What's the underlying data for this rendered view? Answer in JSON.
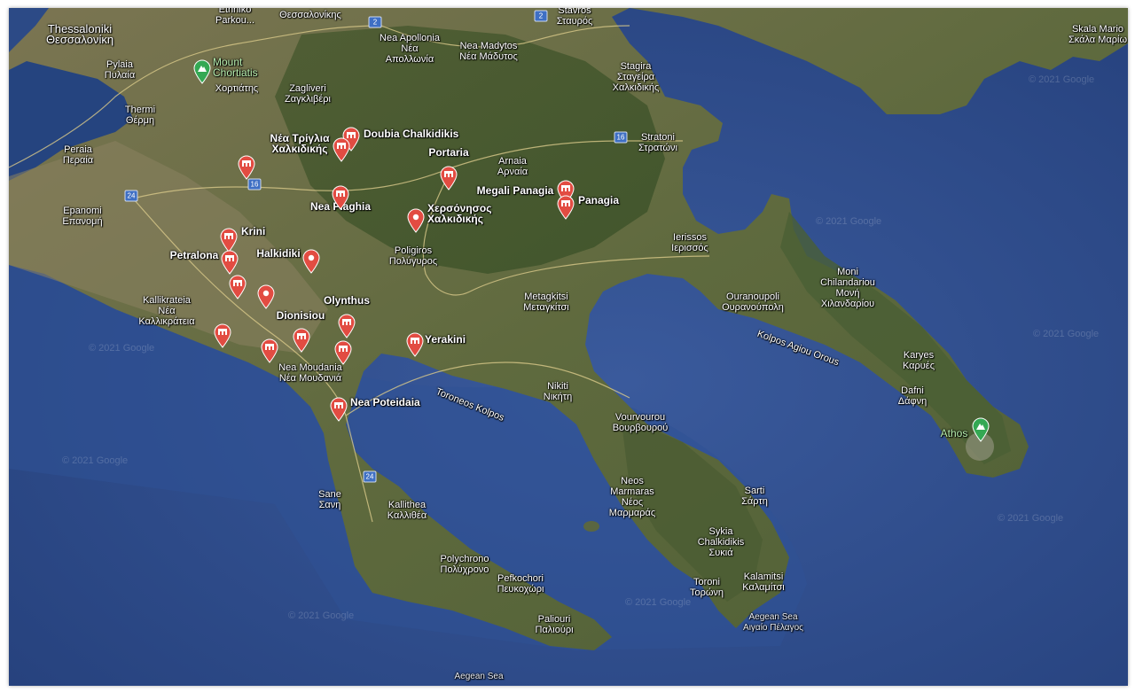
{
  "map": {
    "watermark": "© 2021 Google",
    "accent_colors": {
      "water": "#2c4a86",
      "land": "#6d6a45",
      "pin": "#e24c42",
      "park": "#34a853"
    }
  },
  "labels": {
    "thessaloniki": [
      "Thessaloniki",
      "Θεσσαλονίκη"
    ],
    "ethniko": [
      "Ethniko",
      "Parkou..."
    ],
    "thessalonikis": [
      "Θεσσαλονίκης"
    ],
    "pylaia": [
      "Pylaia",
      "Πυλαία"
    ],
    "mount_chortiatis": [
      "Mount",
      "Chortiatis"
    ],
    "chortiatis_gr": [
      "Χορτιάτης"
    ],
    "zagliveri": [
      "Zagliveri",
      "Ζαγκλιβέρι"
    ],
    "thermi": [
      "Thermi",
      "Θέρμη"
    ],
    "nea_apollonia": [
      "Nea Apollonia",
      "Νέα",
      "Απολλωνία"
    ],
    "nea_madytos": [
      "Nea Madytos",
      "Νέα Μάδυτος"
    ],
    "stavros": [
      "Stavros",
      "Σταυρός"
    ],
    "stagira": [
      "Stagira",
      "Σταγείρα",
      "Χαλκιδικής"
    ],
    "stratoni": [
      "Stratoni",
      "Στρατώνι"
    ],
    "skala_marion": [
      "Skala Mario",
      "Σκάλα Μαρίω"
    ],
    "peraia": [
      "Peraia",
      "Περαία"
    ],
    "nea_triglia": [
      "Νέα Τρίγλια",
      "Χαλκιδικής"
    ],
    "doubia": [
      "Doubia Chalkidikis"
    ],
    "portaria": [
      "Portaria"
    ],
    "arnaia": [
      "Arnaia",
      "Αρναία"
    ],
    "megali_panagia": [
      "Megali Panagia"
    ],
    "panagia": [
      "Panagia"
    ],
    "epanomi": [
      "Epanomi",
      "Επανομή"
    ],
    "nea_plaghia": [
      "Nea Plaghia"
    ],
    "chersonisos": [
      "Χερσόνησος",
      "Χαλκιδικής"
    ],
    "krini": [
      "Krini"
    ],
    "petralona": [
      "Petralona"
    ],
    "halkidiki": [
      "Halkidiki"
    ],
    "poligiros": [
      "Poligiros",
      "Πολύγυρος"
    ],
    "ierissos": [
      "Ierissos",
      "Ιερισσός"
    ],
    "moni_chilandariou": [
      "Moni",
      "Chilandariou",
      "Μονή",
      "Χιλανδαρίου"
    ],
    "ouranoupoli": [
      "Ouranoupoli",
      "Ουρανούπολη"
    ],
    "metagkitsi": [
      "Metagkitsi",
      "Μεταγκίτσι"
    ],
    "olynthus": [
      "Olynthus"
    ],
    "kallikrateia": [
      "Kallikrateia",
      "Νέα",
      "Καλλικράτεια"
    ],
    "dionisiou": [
      "Dionisiou"
    ],
    "yerakini": [
      "Yerakini"
    ],
    "kolpos_agiou_orous": [
      "Kolpos Agiou Orous"
    ],
    "karyes": [
      "Karyes",
      "Καρυές"
    ],
    "nea_moudania": [
      "Nea Moudania",
      "Νέα Μουδανιά"
    ],
    "nea_poteidaia": [
      "Nea Poteidaia"
    ],
    "toroneos_kolpos": [
      "Toroneos Kolpos"
    ],
    "nikiti": [
      "Nikiti",
      "Νικήτη"
    ],
    "vourvourou": [
      "Vourvourou",
      "Βουρβουρού"
    ],
    "dafni": [
      "Dafni",
      "Δάφνη"
    ],
    "athos": [
      "Athos"
    ],
    "sane": [
      "Sane",
      "Σανη"
    ],
    "kallithea": [
      "Kallithea",
      "Καλλιθέα"
    ],
    "neos_marmaras": [
      "Neos",
      "Marmaras",
      "Νέος",
      "Μαρμαράς"
    ],
    "sarti": [
      "Sarti",
      "Σάρτη"
    ],
    "sykia": [
      "Sykia",
      "Chalkidikis",
      "Συκιά"
    ],
    "polychrono": [
      "Polychrono",
      "Πολύχρονο"
    ],
    "pefkochori": [
      "Pefkochori",
      "Πευκοχώρι"
    ],
    "kalamitsi": [
      "Kalamitsi",
      "Καλαμίτσι"
    ],
    "toroni": [
      "Toroni",
      "Τορώνη"
    ],
    "paliouri": [
      "Paliouri",
      "Παλιούρι"
    ],
    "aegean_sea_1": [
      "Aegean Sea",
      "Αιγαίο Πέλαγος"
    ],
    "aegean_sea_2": [
      "Aegean Sea"
    ]
  },
  "road_shields": [
    "2",
    "2",
    "24",
    "16",
    "16",
    "24"
  ]
}
